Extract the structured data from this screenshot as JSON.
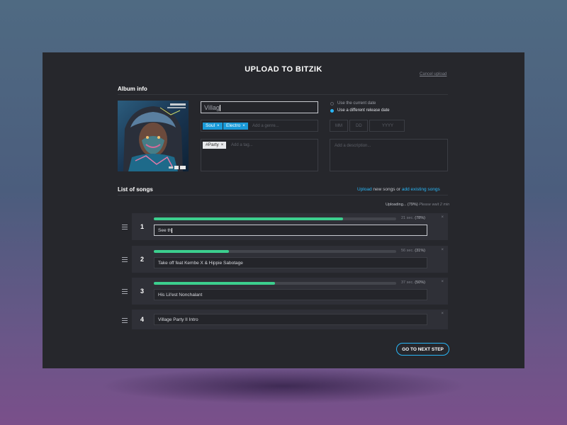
{
  "colors": {
    "accent": "#29b6f6",
    "progress": "#3ccf8e",
    "panel": "#26272c"
  },
  "header": {
    "title": "UPLOAD TO BITZIK",
    "cancel": "Cancel upload"
  },
  "album": {
    "section_label": "Album info",
    "title_value": "Villag",
    "genres": [
      {
        "label": "Soul"
      },
      {
        "label": "Electro"
      }
    ],
    "genre_placeholder": "Add a genre...",
    "tags": [
      {
        "label": "#Party"
      }
    ],
    "tag_placeholder": "Add a tag...",
    "date_options": [
      {
        "label": "Use the current date",
        "selected": false
      },
      {
        "label": "Use a different release date",
        "selected": true
      }
    ],
    "date_fields": {
      "mm": "MM",
      "dd": "DD",
      "yyyy": "YYYY"
    },
    "description_placeholder": "Add a description..."
  },
  "songs_section": {
    "label": "List of songs",
    "upload_link": "Upload",
    "middle_text": "new songs or",
    "add_existing_link": "add existing songs",
    "status": "Uploading... (79%)",
    "status_wait": "Please wait 2 min"
  },
  "songs": [
    {
      "number": "1",
      "title": "See th",
      "progress": 0.78,
      "time": "21 sec.",
      "percent": "(78%)"
    },
    {
      "number": "2",
      "title": "Take off feat Kembe X & Hippie Sabotage",
      "progress": 0.31,
      "time": "56 sec.",
      "percent": "(31%)"
    },
    {
      "number": "3",
      "title": "His Lil'est Nonchalant",
      "progress": 0.5,
      "time": "37 sec.",
      "percent": "(50%)"
    },
    {
      "number": "4",
      "title": "Village Party II Intro"
    }
  ],
  "footer": {
    "next_button": "GO TO NEXT STEP"
  }
}
